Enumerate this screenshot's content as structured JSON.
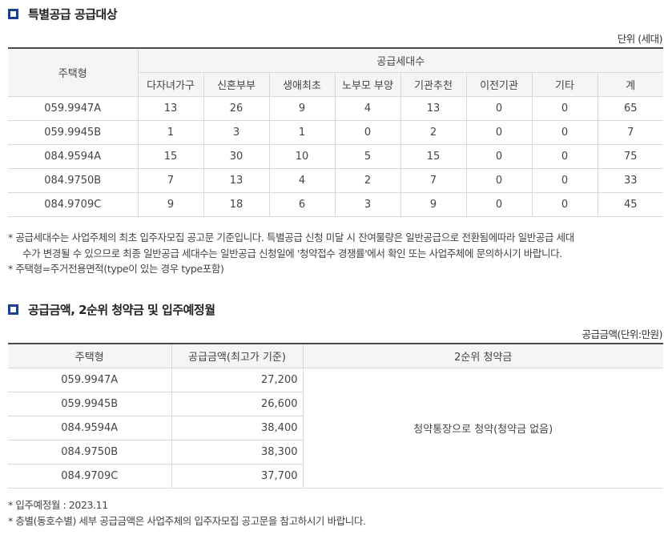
{
  "section1": {
    "title": "특별공급 공급대상",
    "unit": "단위 (세대)",
    "table": {
      "col_type": "주택형",
      "group_header": "공급세대수",
      "sub_headers": [
        "다자녀가구",
        "신혼부부",
        "생애최초",
        "노부모 부양",
        "기관추천",
        "이전기관",
        "기타",
        "계"
      ],
      "rows": [
        [
          "059.9947A",
          "13",
          "26",
          "9",
          "4",
          "13",
          "0",
          "0",
          "65"
        ],
        [
          "059.9945B",
          "1",
          "3",
          "1",
          "0",
          "2",
          "0",
          "0",
          "7"
        ],
        [
          "084.9594A",
          "15",
          "30",
          "10",
          "5",
          "15",
          "0",
          "0",
          "75"
        ],
        [
          "084.9750B",
          "7",
          "13",
          "4",
          "2",
          "7",
          "0",
          "0",
          "33"
        ],
        [
          "084.9709C",
          "9",
          "18",
          "6",
          "3",
          "9",
          "0",
          "0",
          "45"
        ]
      ]
    },
    "notes": [
      "* 공급세대수는 사업주체의 최초 입주자모집 공고문 기준입니다. 특별공급 신청 미달 시 잔여물량은 일반공급으로 전환됨에따라 일반공급 세대",
      "수가 변경될 수 있으므로 최종 일반공급 세대수는 일반공급 신청일에 '청약접수 경쟁률'에서 확인 또는 사업주체에 문의하시기 바랍니다.",
      "* 주택형=주거전용면적(type이 있는 경우 type포함)"
    ]
  },
  "section2": {
    "title": "공급금액, 2순위 청약금 및 입주예정월",
    "unit": "공급금액(단위:만원)",
    "table": {
      "headers": [
        "주택형",
        "공급금액(최고가 기준)",
        "2순위 청약금"
      ],
      "rows": [
        [
          "059.9947A",
          "27,200"
        ],
        [
          "059.9945B",
          "26,600"
        ],
        [
          "084.9594A",
          "38,400"
        ],
        [
          "084.9750B",
          "38,300"
        ],
        [
          "084.9709C",
          "37,700"
        ]
      ],
      "merged_value": "청약통장으로 청약(청약금 없음)"
    },
    "notes": [
      "* 입주예정월 : 2023.11",
      "* 층별(동호수별) 세부 공급금액은 사업주체의 입주자모집 공고문을 참고하시기 바랍니다."
    ]
  },
  "colors": {
    "title_icon": "#1e3e8e",
    "header_bg": "#f5f5f5",
    "border": "#d9d9d9",
    "top_border": "#4a4a4a"
  }
}
